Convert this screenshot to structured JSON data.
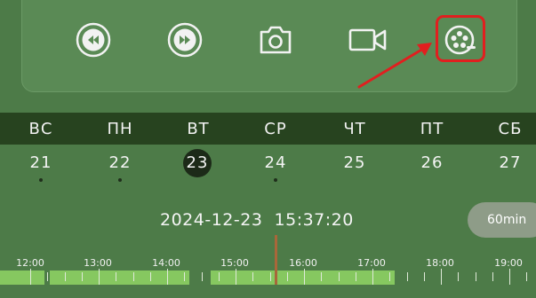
{
  "controls": [
    {
      "icon": "rewind-icon"
    },
    {
      "icon": "fast-forward-icon"
    },
    {
      "icon": "camera-icon"
    },
    {
      "icon": "video-record-icon"
    },
    {
      "icon": "film-reel-icon"
    }
  ],
  "colors": {
    "background": "#4d7b48",
    "panel": "#5a8a55",
    "weekbar": "#27431f",
    "highlight": "#e11f1f",
    "recording": "#86c860",
    "cursor": "#a8673a"
  },
  "week": {
    "days": [
      {
        "dow": "ВС",
        "date": "21",
        "has_records": true
      },
      {
        "dow": "ПН",
        "date": "22",
        "has_records": true
      },
      {
        "dow": "ВТ",
        "date": "23",
        "has_records": false,
        "selected": true
      },
      {
        "dow": "СР",
        "date": "24",
        "has_records": true
      },
      {
        "dow": "ЧТ",
        "date": "25",
        "has_records": false
      },
      {
        "dow": "ПТ",
        "date": "26",
        "has_records": false
      },
      {
        "dow": "СБ",
        "date": "27",
        "has_records": false
      }
    ]
  },
  "playback": {
    "date": "2024-12-23",
    "time": "15:37:20",
    "zoom_label": "60min"
  },
  "timeline": {
    "labels": [
      "12:00",
      "13:00",
      "14:00",
      "15:00",
      "16:00",
      "17:00",
      "18:00",
      "19:00"
    ]
  }
}
